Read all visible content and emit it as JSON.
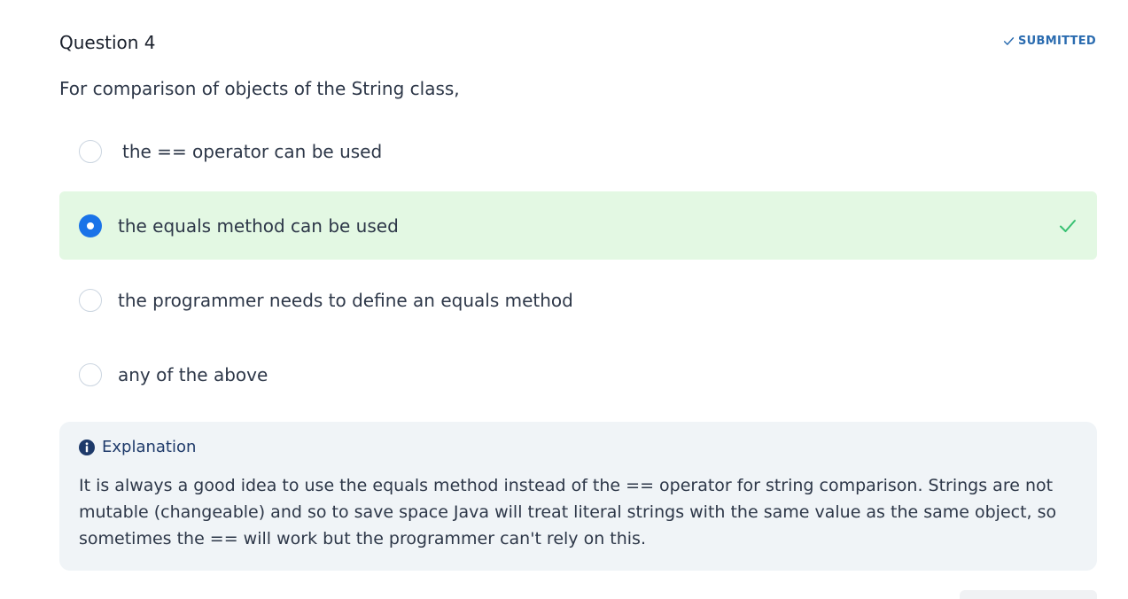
{
  "question": {
    "title": "Question 4",
    "status": "SUBMITTED",
    "text": "For comparison of objects of the String class,"
  },
  "options": [
    {
      "label": "the == operator can be used",
      "selected": false
    },
    {
      "label": "the equals method can be used",
      "selected": true,
      "correct": true
    },
    {
      "label": "the programmer needs to define an equals method",
      "selected": false
    },
    {
      "label": "any of the above",
      "selected": false
    }
  ],
  "explanation": {
    "heading": "Explanation",
    "body": "It is always a good idea to use the equals method instead of the == operator for string comparison. Strings are not mutable (changeable) and so to save space Java will treat literal strings with the same value as the same object, so sometimes the == will work but the programmer can't rely on this."
  },
  "colors": {
    "accent": "#1a73e8",
    "correct_bg": "#e3f8e3",
    "correct_check": "#38c172",
    "status": "#2b6cb0",
    "explanation_bg": "#f0f4f7"
  },
  "icons": {
    "status": "check-icon",
    "correct": "check-icon",
    "explanation": "info-circle-icon"
  }
}
